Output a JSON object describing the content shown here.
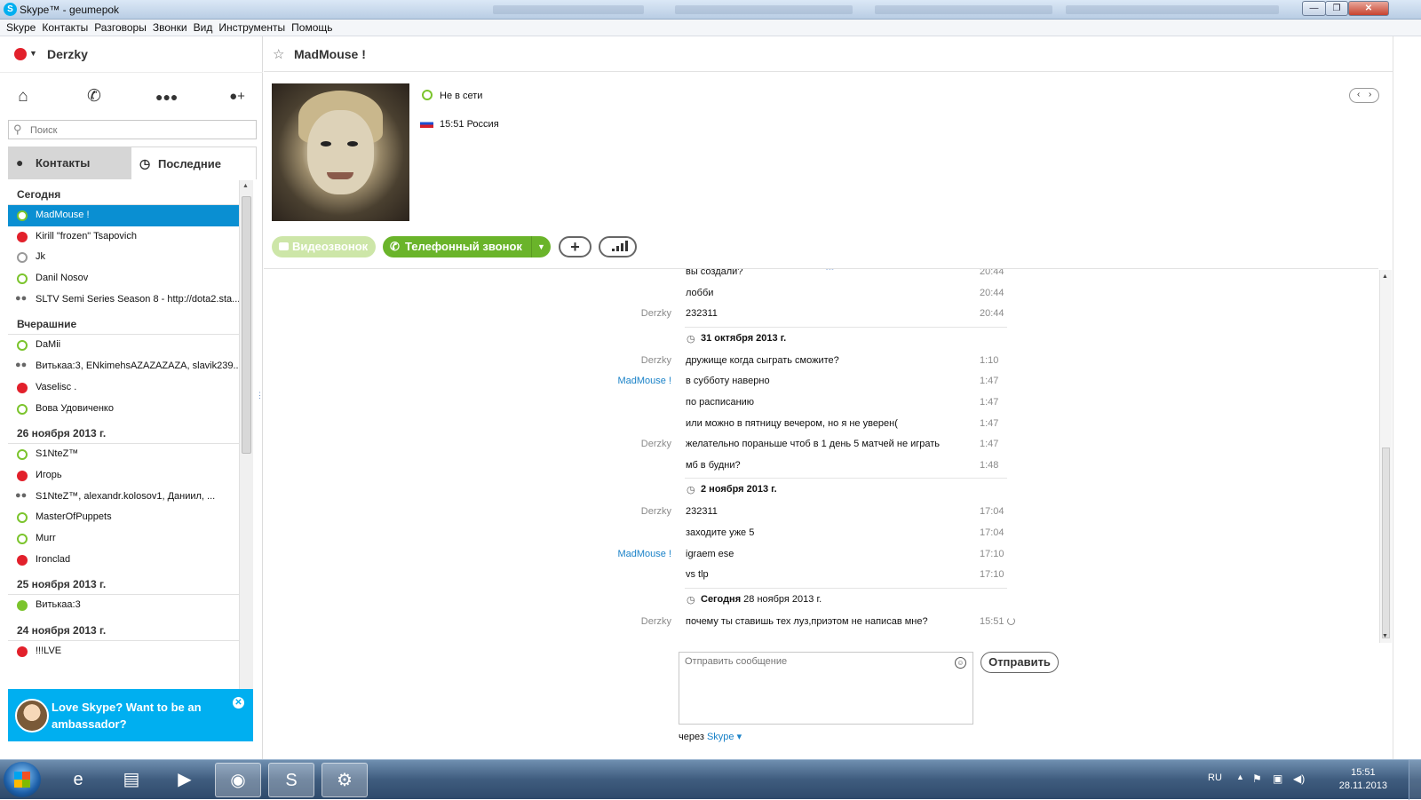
{
  "window": {
    "title": "Skype™ - geumepok",
    "controls": {
      "minimize": "—",
      "maximize": "❐",
      "close": "✕"
    }
  },
  "menu": [
    "Skype",
    "Контакты",
    "Разговоры",
    "Звонки",
    "Вид",
    "Инструменты",
    "Помощь"
  ],
  "sidebar": {
    "user_name": "Derzky",
    "search_placeholder": "Поиск",
    "tabs": {
      "contacts": "Контакты",
      "recent": "Последние"
    },
    "groups": [
      {
        "label": "Сегодня",
        "items": [
          {
            "name": "MadMouse !",
            "status": "offline",
            "selected": true
          },
          {
            "name": "Kirill \"frozen\" Tsapovich",
            "status": "busy"
          },
          {
            "name": "Jk",
            "status": "unknown"
          },
          {
            "name": "Danil Nosov",
            "status": "offline"
          },
          {
            "name": "SLTV Semi Series Season 8 - http://dota2.sta...",
            "status": "group"
          }
        ]
      },
      {
        "label": "Вчерашние",
        "items": [
          {
            "name": "DaMii",
            "status": "offline"
          },
          {
            "name": "Витькаа:3, ENkimehsAZAZAZAZA, slavik239...",
            "status": "group"
          },
          {
            "name": "Vaselisc .",
            "status": "busy"
          },
          {
            "name": "Вова Удовиченко",
            "status": "offline"
          }
        ]
      },
      {
        "label": "26 ноября 2013 г.",
        "items": [
          {
            "name": "S1NteZ™",
            "status": "offline"
          },
          {
            "name": "Игорь",
            "status": "busy"
          },
          {
            "name": "S1NteZ™, alexandr.kolosov1, Даниил, ...",
            "status": "group"
          },
          {
            "name": "MasterOfPuppets",
            "status": "offline"
          },
          {
            "name": "Murr",
            "status": "offline"
          },
          {
            "name": "Ironclad",
            "status": "busy"
          }
        ]
      },
      {
        "label": "25 ноября 2013 г.",
        "items": [
          {
            "name": "Витькаа:3",
            "status": "online"
          }
        ]
      },
      {
        "label": "24 ноября 2013 г.",
        "items": [
          {
            "name": "!!!LVE",
            "status": "busy"
          }
        ]
      }
    ],
    "promo_text": "Love Skype? Want to be an ambassador?"
  },
  "conversation": {
    "contact_name": "MadMouse !",
    "status": "Не в сети",
    "local_time": "15:51 Россия",
    "buttons": {
      "video": "Видеозвонок",
      "phone": "Телефонный звонок",
      "add": "+"
    },
    "rows": [
      {
        "type": "msg",
        "who": "",
        "text": "вы создали?",
        "time": "20:44"
      },
      {
        "type": "msg",
        "who": "",
        "text": "лобби",
        "time": "20:44"
      },
      {
        "type": "msg",
        "who": "Derzky",
        "text": "232311",
        "time": "20:44"
      },
      {
        "type": "date",
        "bold": "31 октября 2013 г.",
        "rest": ""
      },
      {
        "type": "msg",
        "who": "Derzky",
        "text": "дружище когда сыграть сможите?",
        "time": "1:10"
      },
      {
        "type": "msg",
        "who": "MadMouse !",
        "her": true,
        "text": "в субботу наверно",
        "time": "1:47"
      },
      {
        "type": "msg",
        "who": "",
        "text": "по расписанию",
        "time": "1:47"
      },
      {
        "type": "msg",
        "who": "",
        "text": "или можно в пятницу вечером, но я не уверен(",
        "time": "1:47"
      },
      {
        "type": "msg",
        "who": "Derzky",
        "text": "желательно пораньше чтоб в 1 день 5 матчей не играть",
        "time": "1:47"
      },
      {
        "type": "msg",
        "who": "",
        "text": "мб в будни?",
        "time": "1:48"
      },
      {
        "type": "date",
        "bold": "2 ноября 2013 г.",
        "rest": ""
      },
      {
        "type": "msg",
        "who": "Derzky",
        "text": "232311",
        "time": "17:04"
      },
      {
        "type": "msg",
        "who": "",
        "text": "заходите уже 5",
        "time": "17:04"
      },
      {
        "type": "msg",
        "who": "MadMouse !",
        "her": true,
        "text": "igraem ese",
        "time": "17:10"
      },
      {
        "type": "msg",
        "who": "",
        "text": "vs tlp",
        "time": "17:10"
      },
      {
        "type": "date",
        "bold": "Сегодня",
        "rest": " 28 ноября 2013 г."
      },
      {
        "type": "msg",
        "who": "Derzky",
        "text": "почему ты ставишь тех луз,приэтом не написав мне?",
        "time": "15:51",
        "pending": true
      }
    ],
    "compose_placeholder": "Отправить сообщение",
    "send_label": "Отправить",
    "via_prefix": "через",
    "via_link": "Skype ▾"
  },
  "taskbar": {
    "apps": [
      "internet-explorer",
      "file-explorer",
      "media-player",
      "firefox",
      "skype",
      "steam"
    ],
    "lang": "RU",
    "time": "15:51",
    "date": "28.11.2013"
  },
  "colors": {
    "skype_blue": "#00aff0",
    "selected_row": "#0a8fd2",
    "call_green": "#6ab42a",
    "busy_red": "#e2202b",
    "online_green": "#7bc42c"
  }
}
